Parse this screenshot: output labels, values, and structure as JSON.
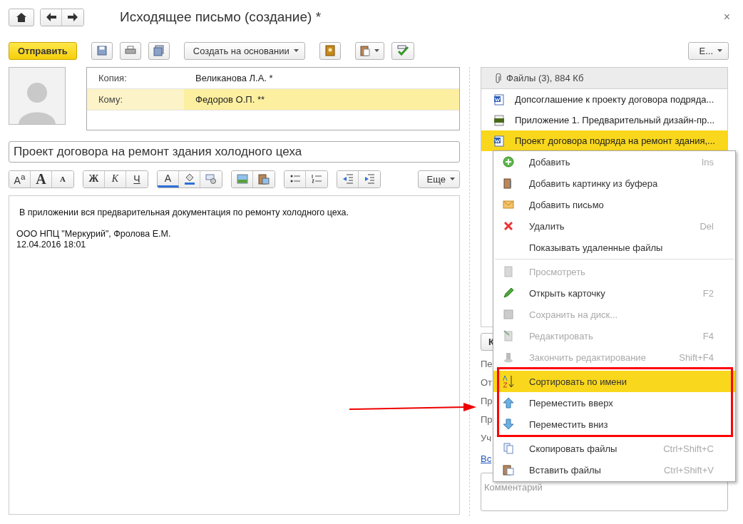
{
  "window": {
    "title": "Исходящее письмо (создание) *",
    "close": "×"
  },
  "toolbar": {
    "send": "Отправить",
    "create_based_on": "Создать на основании",
    "more": "Е..."
  },
  "recipients": [
    {
      "label": "Копия:",
      "value": "Великанова Л.А. *",
      "selected": false
    },
    {
      "label": "Кому:",
      "value": "Федоров О.П. **",
      "selected": true
    }
  ],
  "subject": {
    "value": "Проект договора на ремонт здания холодного цеха"
  },
  "format_toolbar": {
    "groups": [
      [
        {
          "kind": "size-default",
          "text": "A$^{a}$"
        },
        {
          "kind": "grow",
          "text": "A"
        },
        {
          "kind": "shrink",
          "text": "A"
        }
      ],
      [
        {
          "kind": "bold",
          "text": "Ж"
        },
        {
          "kind": "italic",
          "text": "К"
        },
        {
          "kind": "underline",
          "text": "Ч"
        }
      ],
      [
        {
          "kind": "color",
          "text": "A"
        },
        {
          "kind": "fill"
        },
        {
          "kind": "style"
        }
      ],
      [
        {
          "kind": "image"
        },
        {
          "kind": "paste-image"
        }
      ],
      [
        {
          "kind": "bullets"
        },
        {
          "kind": "numbers"
        }
      ],
      [
        {
          "kind": "outdent"
        },
        {
          "kind": "indent"
        }
      ]
    ],
    "more": "Еще"
  },
  "body": {
    "paragraphs": [
      [
        "В приложении вся предварительная документация по ремонту холодного цеха."
      ],
      [
        "ООО НПЦ \"Меркурий\", Фролова Е.М.",
        "12.04.2016 18:01"
      ]
    ]
  },
  "files": {
    "header": "Файлы (3), 884 Кб",
    "items": [
      {
        "name": "Допсоглашение к проекту договора подряда...",
        "kind": "doc",
        "selected": false
      },
      {
        "name": "Приложение 1. Предварительный дизайн-пр...",
        "kind": "jpg",
        "selected": false
      },
      {
        "name": "Проект договора подряда на ремонт здания,...",
        "kind": "doc",
        "selected": true
      }
    ]
  },
  "side": {
    "button": "К",
    "labels": [
      "Пе",
      "От",
      "Пр",
      "Пр",
      "Уч"
    ],
    "link": "Вс",
    "comment_placeholder": "Комментарий"
  },
  "context_menu": {
    "items": [
      {
        "kind": "item",
        "label": "Добавить",
        "shortcut": "Ins",
        "disabled": false,
        "selected": false
      },
      {
        "kind": "item",
        "label": "Добавить картинку из буфера",
        "disabled": false,
        "selected": false
      },
      {
        "kind": "item",
        "label": "Добавить письмо",
        "disabled": false,
        "selected": false
      },
      {
        "kind": "item",
        "label": "Удалить",
        "shortcut": "Del",
        "disabled": false,
        "selected": false
      },
      {
        "kind": "item",
        "label": "Показывать удаленные файлы",
        "disabled": false,
        "selected": false
      },
      {
        "kind": "separator"
      },
      {
        "kind": "item",
        "label": "Просмотреть",
        "disabled": true,
        "selected": false
      },
      {
        "kind": "item",
        "label": "Открыть карточку",
        "shortcut": "F2",
        "disabled": false,
        "selected": false
      },
      {
        "kind": "item",
        "label": "Сохранить на диск...",
        "disabled": true,
        "selected": false
      },
      {
        "kind": "item",
        "label": "Редактировать",
        "shortcut": "F4",
        "disabled": true,
        "selected": false
      },
      {
        "kind": "item",
        "label": "Закончить редактирование",
        "shortcut": "Shift+F4",
        "disabled": true,
        "selected": false
      },
      {
        "kind": "separator"
      },
      {
        "kind": "item",
        "label": "Сортировать по имени",
        "disabled": false,
        "selected": true
      },
      {
        "kind": "item",
        "label": "Переместить вверх",
        "disabled": false,
        "selected": false
      },
      {
        "kind": "item",
        "label": "Переместить вниз",
        "disabled": false,
        "selected": false
      },
      {
        "kind": "separator"
      },
      {
        "kind": "item",
        "label": "Скопировать файлы",
        "shortcut": "Ctrl+Shift+C",
        "disabled": false,
        "selected": false
      },
      {
        "kind": "item",
        "label": "Вставить файлы",
        "shortcut": "Ctrl+Shift+V",
        "disabled": false,
        "selected": false
      }
    ]
  }
}
